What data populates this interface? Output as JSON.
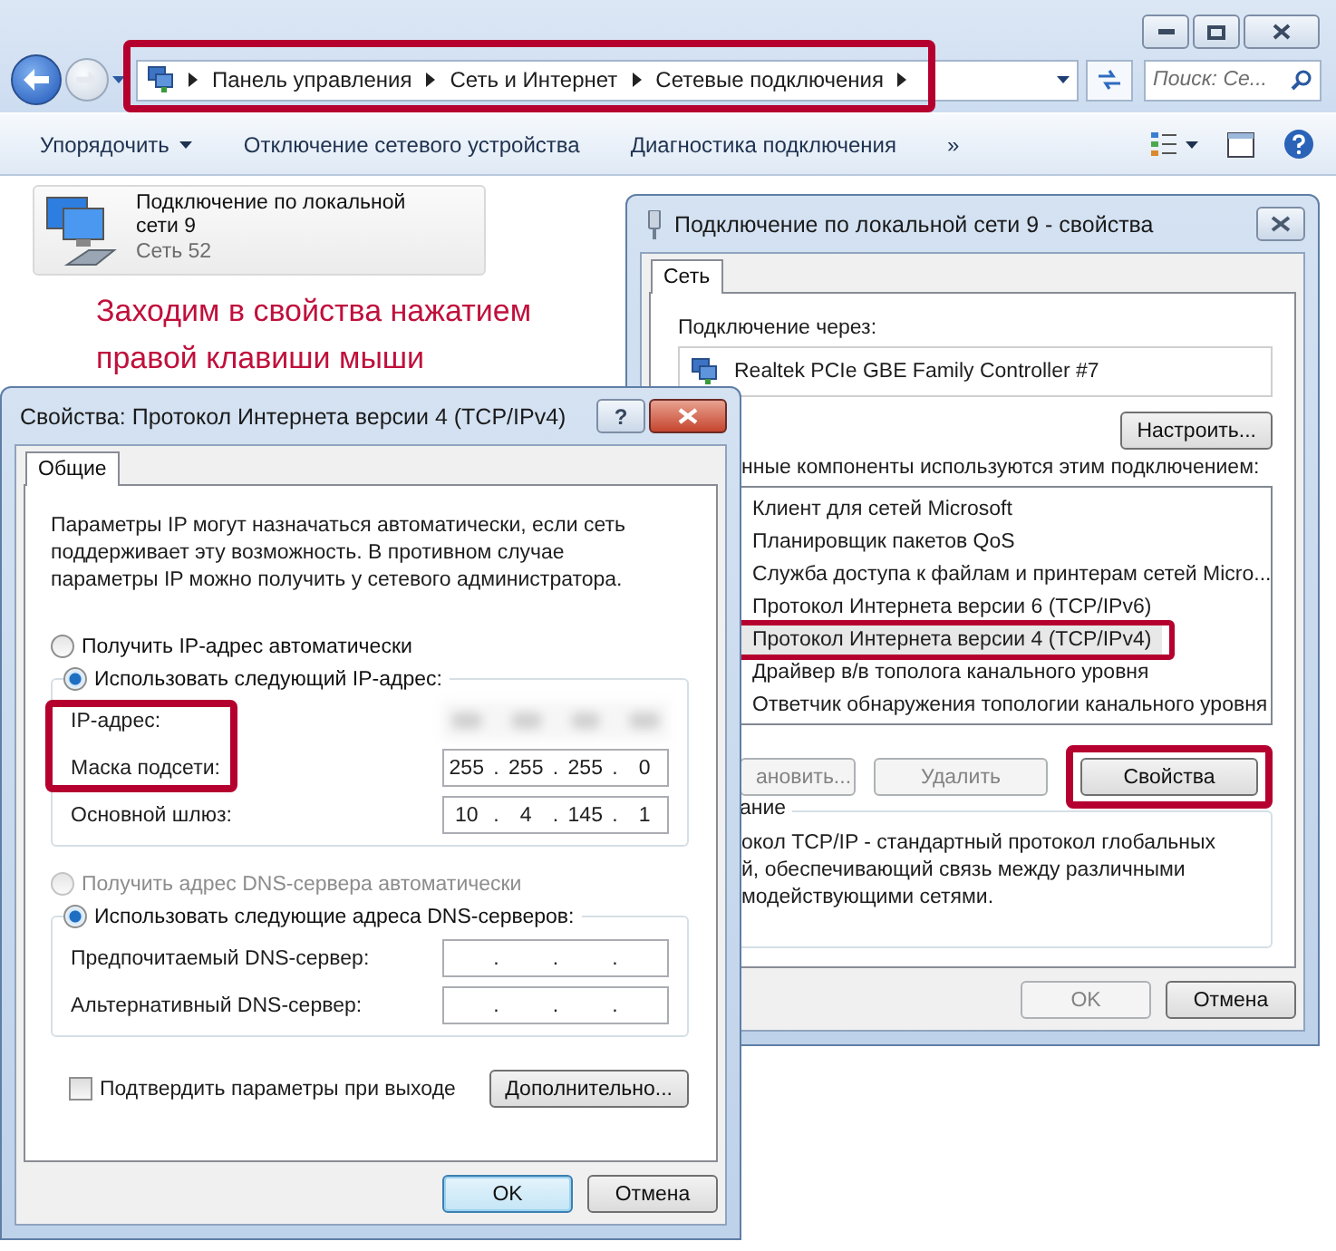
{
  "explorer": {
    "breadcrumbs": [
      "Панель управления",
      "Сеть и Интернет",
      "Сетевые подключения"
    ],
    "search": {
      "placeholder": "Поиск: Се..."
    },
    "toolbar": [
      {
        "label": "Упорядочить",
        "dropdown": true
      },
      {
        "label": "Отключение сетевого устройства",
        "dropdown": false
      },
      {
        "label": "Диагностика подключения",
        "dropdown": false
      }
    ],
    "more": "»",
    "connection": {
      "name": "Подключение по локальной сети 9",
      "network": "Сеть  52"
    },
    "annotation": "Заходим в свойства нажатием правой клавиши мыши"
  },
  "connection_properties": {
    "title": "Подключение по локальной сети 9 - свойства",
    "tabs": [
      {
        "label": "Сеть",
        "selected": true
      }
    ],
    "connect_using_label": "Подключение через:",
    "adapter": "Realtek PCIe GBE Family Controller #7",
    "configure_button": "Настроить...",
    "components_label": "нные компоненты используются этим подключением:",
    "components": [
      {
        "label": "Клиент для сетей Microsoft",
        "selected": false
      },
      {
        "label": "Планировщик пакетов QoS",
        "selected": false
      },
      {
        "label": "Служба доступа к файлам и принтерам сетей Micro...",
        "selected": false
      },
      {
        "label": "Протокол Интернета версии 6 (TCP/IPv6)",
        "selected": false
      },
      {
        "label": "Протокол Интернета версии 4 (TCP/IPv4)",
        "selected": true
      },
      {
        "label": "Драйвер в/в тополога канального уровня",
        "selected": false
      },
      {
        "label": "Ответчик обнаружения топологии канального уровня",
        "selected": false
      }
    ],
    "component_buttons": [
      {
        "label": "ановить...",
        "disabled": true
      },
      {
        "label": "Удалить",
        "disabled": true
      },
      {
        "label": "Свойства",
        "disabled": false
      }
    ],
    "description_legend": "ание",
    "description_lines": [
      "окол TCP/IP - стандартный протокол глобальных",
      "й, обеспечивающий связь между различными",
      "модействующими сетями."
    ],
    "buttons": [
      {
        "label": "OK",
        "disabled": true
      },
      {
        "label": "Отмена",
        "disabled": false
      }
    ]
  },
  "ipv4_properties": {
    "title": "Свойства: Протокол Интернета версии 4 (TCP/IPv4)",
    "help": "?",
    "tabs": [
      {
        "label": "Общие",
        "selected": true
      }
    ],
    "intro": "Параметры IP могут назначаться автоматически, если сеть поддерживает эту возможность. В противном случае параметры IP можно получить у сетевого администратора.",
    "separator": ".",
    "ip_mode": [
      {
        "label": "Получить IP-адрес автоматически",
        "selected": false,
        "disabled": false
      },
      {
        "label": "Использовать следующий IP-адрес:",
        "selected": true,
        "disabled": false
      }
    ],
    "ip_fields": [
      {
        "label": "IP-адрес:",
        "blurred": true
      },
      {
        "label": "Маска подсети:",
        "octets": [
          "255",
          "255",
          "255",
          "0"
        ]
      },
      {
        "label": "Основной шлюз:",
        "octets": [
          "10",
          "4",
          "145",
          "1"
        ]
      }
    ],
    "dns_mode": [
      {
        "label": "Получить адрес DNS-сервера автоматически",
        "selected": false,
        "disabled": true
      },
      {
        "label": "Использовать следующие адреса DNS-серверов:",
        "selected": true,
        "disabled": false
      }
    ],
    "dns_fields": [
      {
        "label": "Предпочитаемый DNS-сервер:"
      },
      {
        "label": "Альтернативный DNS-сервер:"
      }
    ],
    "confirm": {
      "label": "Подтвердить параметры при выходе",
      "checked": false
    },
    "advanced_button": "Дополнительно...",
    "buttons": [
      {
        "label": "OK",
        "default": true
      },
      {
        "label": "Отмена",
        "default": false
      }
    ]
  }
}
